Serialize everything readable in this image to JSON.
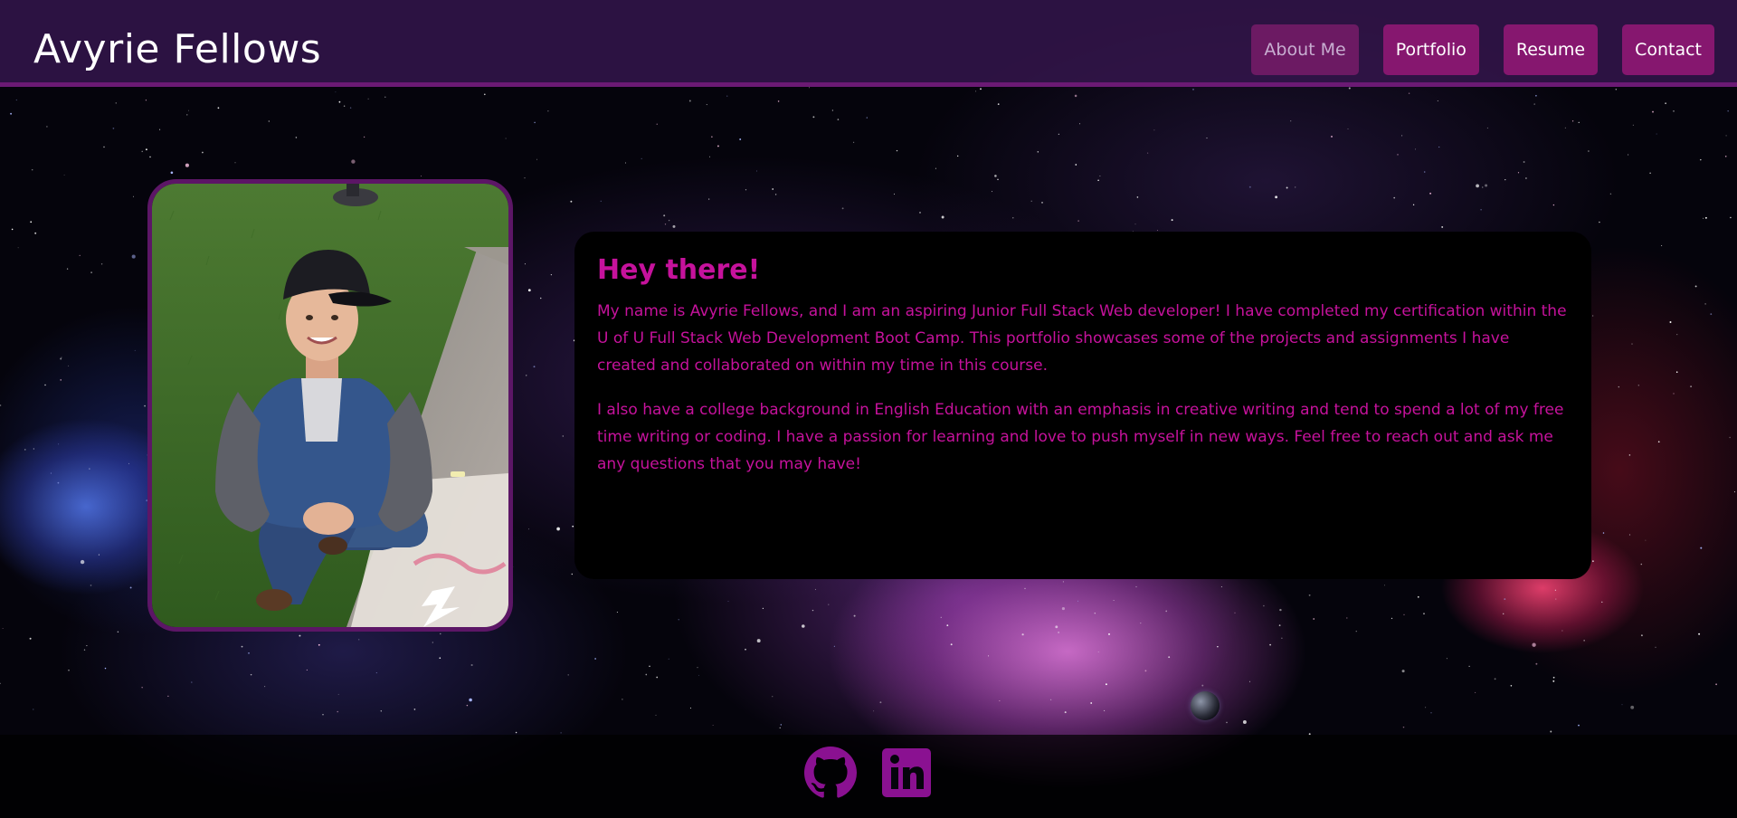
{
  "header": {
    "title": "Avyrie Fellows",
    "nav": [
      {
        "label": "About Me",
        "active": true
      },
      {
        "label": "Portfolio",
        "active": false
      },
      {
        "label": "Resume",
        "active": false
      },
      {
        "label": "Contact",
        "active": false
      }
    ]
  },
  "about": {
    "heading": "Hey there!",
    "paragraphs": [
      "My name is Avyrie Fellows, and I am an aspiring Junior Full Stack Web developer! I have completed my certification within the U of U Full Stack Web Development Boot Camp. This portfolio showcases some of the projects and assignments I have created and collaborated on within my time in this course.",
      "I also have a college background in English Education with an emphasis in creative writing and tend to spend a lot of my free time writing or coding. I have a passion for learning and love to push myself in new ways. Feel free to reach out and ask me any questions that you may have!"
    ]
  },
  "footer": {
    "social": [
      {
        "icon": "github-icon"
      },
      {
        "icon": "linkedin-icon"
      }
    ]
  },
  "colors": {
    "accent": "#86176f",
    "header_bg": "#36164e",
    "header_border": "#6b1a74",
    "text_pink": "#c6129c",
    "icon_purple": "#8a1191"
  }
}
